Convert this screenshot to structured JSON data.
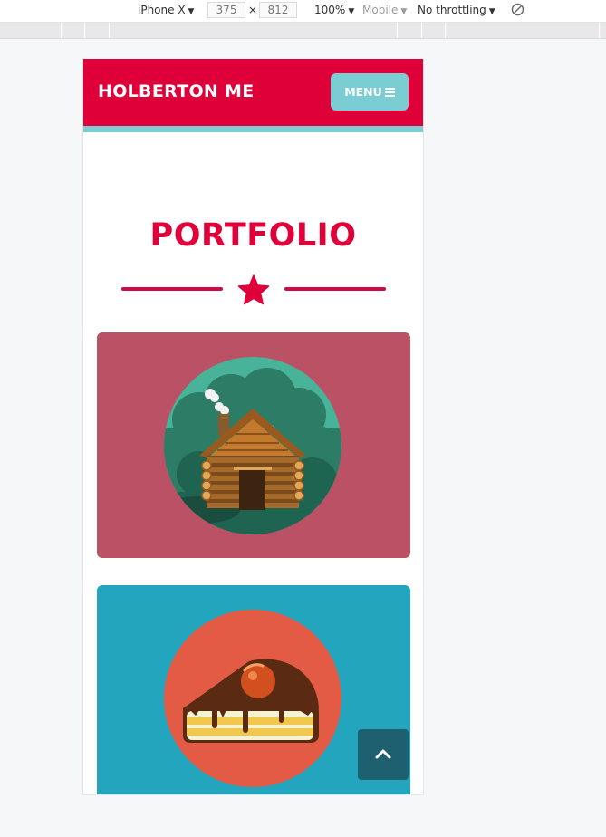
{
  "devtools": {
    "device": "iPhone X",
    "width": "375",
    "height": "812",
    "zoom": "100%",
    "mode": "Mobile",
    "throttling": "No throttling",
    "times": "×"
  },
  "nav": {
    "brand": "HOLBERTON ME",
    "menu_label": "MENU"
  },
  "portfolio": {
    "title": "PORTFOLIO",
    "items": [
      {
        "image": "cabin-illustration",
        "background": "#bb5165"
      },
      {
        "image": "cake-illustration",
        "background": "#22a5bd"
      }
    ]
  },
  "colors": {
    "primary": "#e00039",
    "accent": "#79cdd3",
    "scroll_button": "#1f6070"
  }
}
